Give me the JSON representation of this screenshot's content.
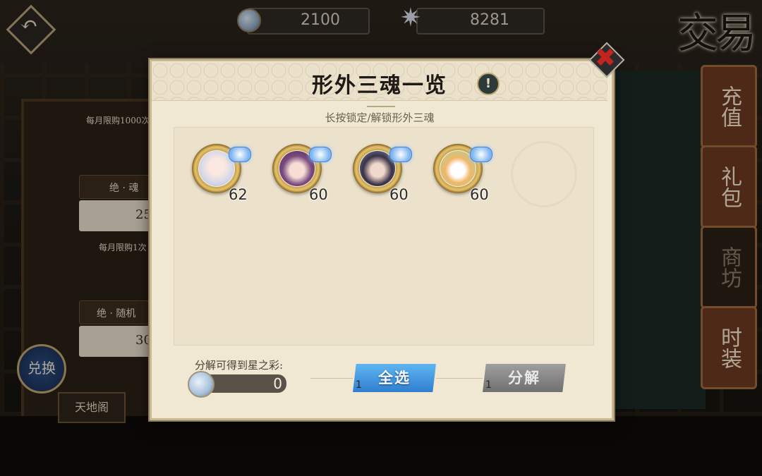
{
  "topbar": {
    "currency1_value": "2100",
    "currency2_value": "8281",
    "page_title": "交易"
  },
  "side_tabs": [
    {
      "label": "充值"
    },
    {
      "label": "礼包"
    },
    {
      "label": "商坊"
    },
    {
      "label": "时装"
    }
  ],
  "background": {
    "left_items": [
      {
        "note": "每月限购1000次",
        "name": "绝 · 魂",
        "price": "25"
      },
      {
        "note": "每月限购1次",
        "name": "绝 · 随机",
        "price": "30"
      }
    ],
    "exchange_label": "兑换",
    "bottom_tab": "天地阁"
  },
  "dialog": {
    "title": "形外三魂一览",
    "info_icon": "!",
    "close_icon": "✖",
    "subtitle": "长按锁定/解锁形外三魂",
    "souls": [
      {
        "level": "62",
        "portrait": "silver-haired-character",
        "color": "#d7d9e8"
      },
      {
        "level": "60",
        "portrait": "purple-haired-character",
        "color": "#7a4a7e"
      },
      {
        "level": "60",
        "portrait": "dark-haired-character",
        "color": "#3a3245"
      },
      {
        "level": "60",
        "portrait": "cat-character",
        "color": "#f0b76b"
      }
    ],
    "yield_label": "分解可得到星之彩:",
    "yield_value": "0",
    "select_all_label": "全选",
    "select_all_tag": "1",
    "decompose_label": "分解",
    "decompose_tag": "1"
  }
}
